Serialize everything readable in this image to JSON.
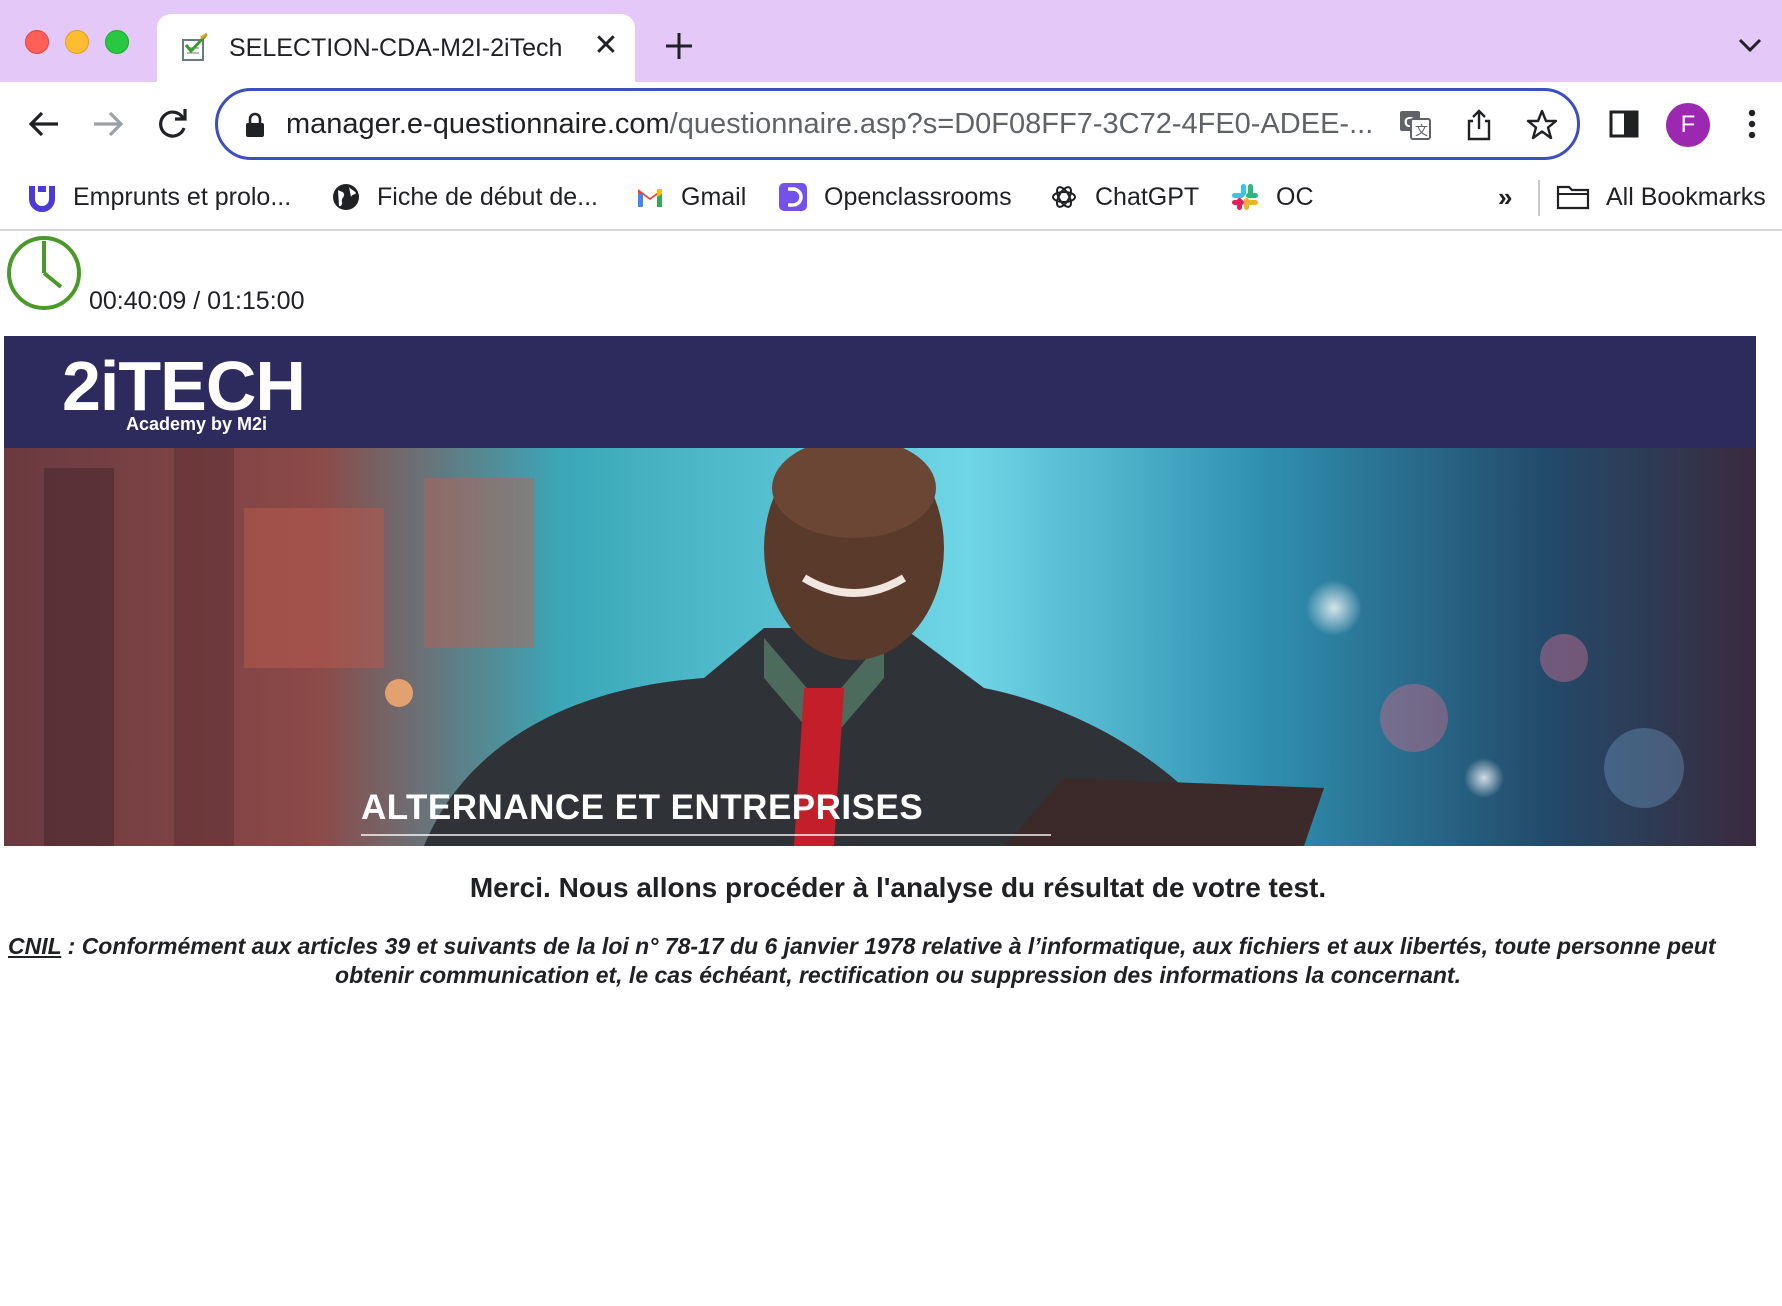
{
  "browser": {
    "tab": {
      "title": "SELECTION-CDA-M2I-2iTech"
    },
    "url": {
      "host": "manager.e-questionnaire.com",
      "path": "/questionnaire.asp?s=D0F08FF7-3C72-4FE0-ADEE-..."
    },
    "profile_initial": "F",
    "bookmarks": [
      {
        "label": "Emprunts et prolo...",
        "icon": "u-shape-icon"
      },
      {
        "label": "Fiche de début de...",
        "icon": "globe-icon"
      },
      {
        "label": "Gmail",
        "icon": "gmail-icon"
      },
      {
        "label": "Openclassrooms",
        "icon": "openclassrooms-icon"
      },
      {
        "label": "ChatGPT",
        "icon": "chatgpt-icon"
      },
      {
        "label": "OC",
        "icon": "slack-icon"
      }
    ],
    "bookmarks_overflow": "»",
    "all_bookmarks_label": "All Bookmarks"
  },
  "page": {
    "timer": "00:40:09 / 01:15:00",
    "banner": {
      "logo": "2iTECH",
      "logo_sub": "Academy by M2i",
      "caption": "ALTERNANCE ET ENTREPRISES"
    },
    "thanks_message": "Merci. Nous allons procéder à l'analyse du résultat de votre test.",
    "cnil": {
      "link": "CNIL",
      "line1": " : Conformément aux articles 39 et suivants de la loi n° 78-17 du 6 janvier 1978 relative à l’informatique, aux fichiers et aux libertés, toute personne peut",
      "line2": "obtenir communication et, le cas échéant, rectification ou suppression des informations la concernant."
    }
  },
  "colors": {
    "tabstrip": "#e4c9f8",
    "omnibox_border": "#3b4fbf",
    "avatar": "#9c27b0",
    "banner_header": "#2d2b5e",
    "timer_green": "#4a9a2a"
  }
}
